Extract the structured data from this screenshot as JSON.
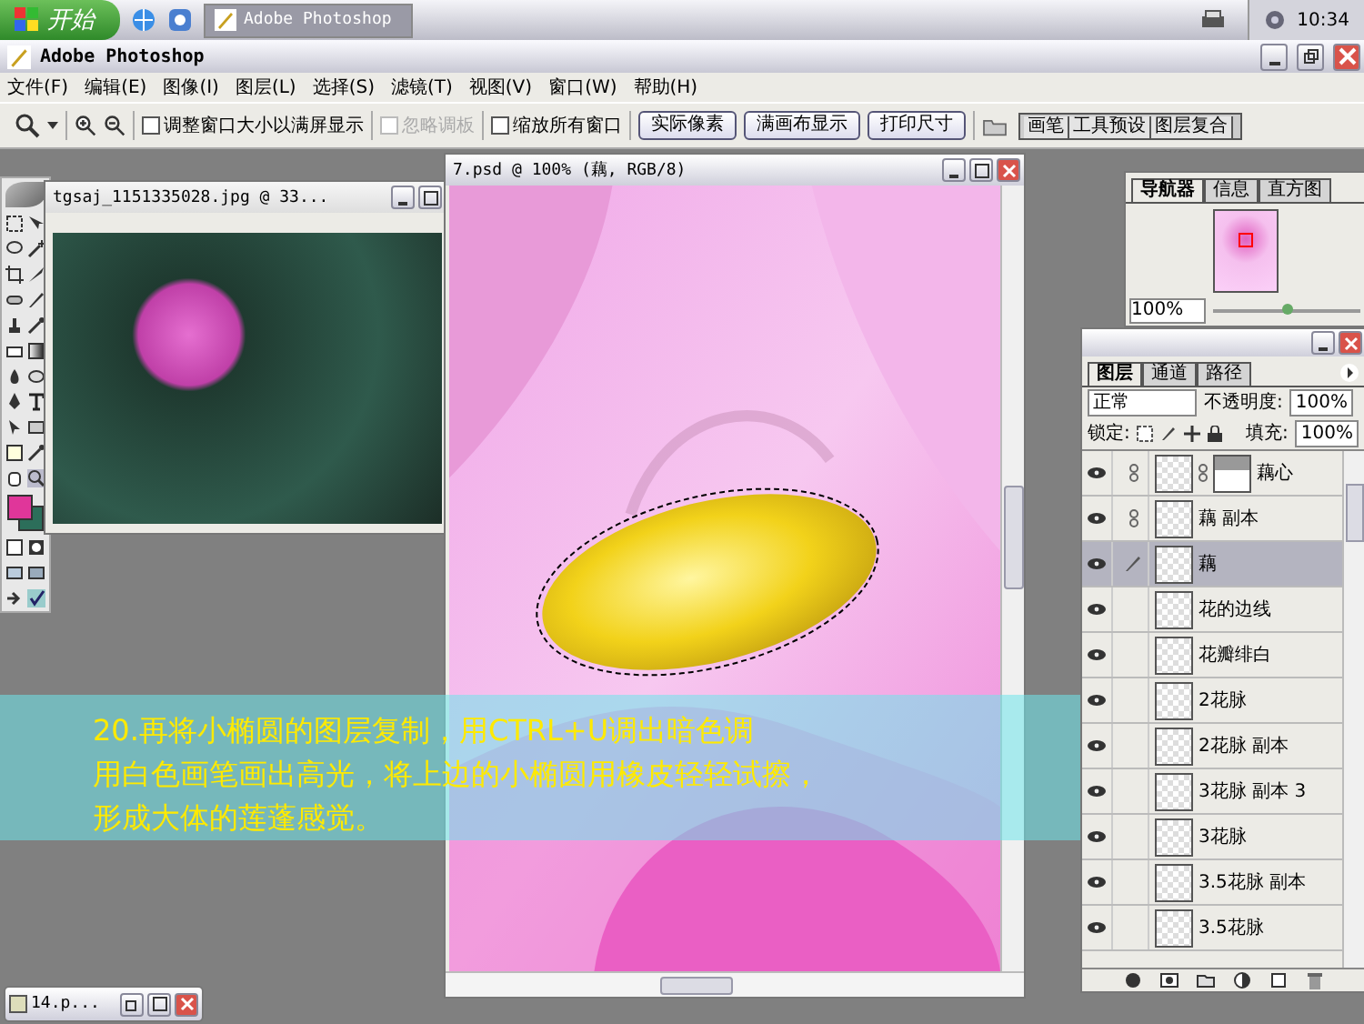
{
  "taskbar": {
    "start": "开始",
    "task": "Adobe Photoshop",
    "clock": "10:34"
  },
  "app": {
    "title": "Adobe Photoshop"
  },
  "menu": [
    "文件(F)",
    "编辑(E)",
    "图像(I)",
    "图层(L)",
    "选择(S)",
    "滤镜(T)",
    "视图(V)",
    "窗口(W)",
    "帮助(H)"
  ],
  "options": {
    "checkboxes": [
      {
        "label": "调整窗口大小以满屏显示",
        "checked": false,
        "disabled": false
      },
      {
        "label": "忽略调板",
        "checked": false,
        "disabled": true
      },
      {
        "label": "缩放所有窗口",
        "checked": false,
        "disabled": false
      }
    ],
    "buttons": [
      "实际像素",
      "满画布显示",
      "打印尺寸"
    ],
    "palette_tabs": [
      "画笔",
      "工具预设",
      "图层复合"
    ]
  },
  "image_window": {
    "title": "tgsaj_1151335028.jpg @ 33..."
  },
  "document": {
    "title": "7.psd @ 100% (藕, RGB/8)"
  },
  "navigator": {
    "tabs": [
      {
        "label": "导航器",
        "selected": true
      },
      {
        "label": "信息",
        "selected": false
      },
      {
        "label": "直方图",
        "selected": false
      }
    ],
    "zoom": "100%",
    "level": 0.5
  },
  "layers_panel": {
    "tabs": [
      {
        "label": "图层",
        "selected": true
      },
      {
        "label": "通道",
        "selected": false
      },
      {
        "label": "路径",
        "selected": false
      }
    ],
    "blend_mode": "正常",
    "opacity_label": "不透明度:",
    "opacity": "100%",
    "lock_label": "锁定:",
    "fill_label": "填充:",
    "fill": "100%",
    "layers": [
      {
        "name": "藕心",
        "visible": true,
        "selected": false,
        "kind": "chain",
        "mask": true
      },
      {
        "name": "藕 副本",
        "visible": true,
        "selected": false,
        "kind": "chain",
        "mask": false
      },
      {
        "name": "藕",
        "visible": true,
        "selected": true,
        "kind": "brush",
        "mask": false
      },
      {
        "name": "花的边线",
        "visible": true,
        "selected": false,
        "kind": "none",
        "mask": false
      },
      {
        "name": "花瓣绯白",
        "visible": true,
        "selected": false,
        "kind": "none",
        "mask": false
      },
      {
        "name": "2花脉",
        "visible": true,
        "selected": false,
        "kind": "none",
        "mask": false
      },
      {
        "name": "2花脉 副本",
        "visible": true,
        "selected": false,
        "kind": "none",
        "mask": false
      },
      {
        "name": "3花脉 副本 3",
        "visible": true,
        "selected": false,
        "kind": "none",
        "mask": false
      },
      {
        "name": "3花脉",
        "visible": true,
        "selected": false,
        "kind": "none",
        "mask": false
      },
      {
        "name": "3.5花脉 副本",
        "visible": true,
        "selected": false,
        "kind": "none",
        "mask": false
      },
      {
        "name": "3.5花脉",
        "visible": true,
        "selected": false,
        "kind": "none",
        "mask": false
      }
    ]
  },
  "caption": [
    "20.再将小椭圆的图层复制，用CTRL+U调出暗色调",
    "用白色画笔画出高光，将上边的小椭圆用橡皮轻轻试擦，",
    "形成大体的莲蓬感觉。"
  ],
  "minimized_window": {
    "title": "14.p..."
  }
}
